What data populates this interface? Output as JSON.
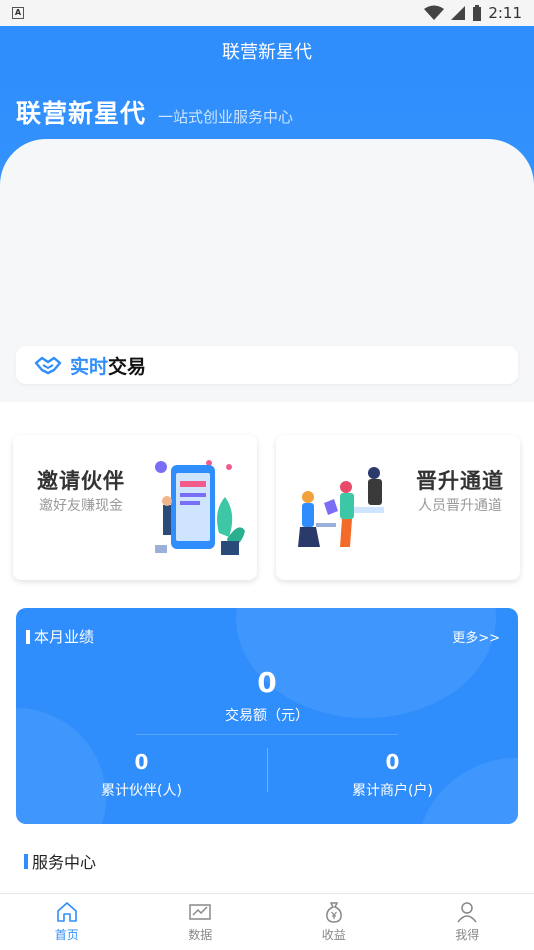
{
  "status_bar": {
    "sim_label": "A",
    "time": "2:11"
  },
  "header": {
    "title": "联营新星代"
  },
  "hero": {
    "brand_name": "联营新星代",
    "brand_slogan": "一站式创业服务中心",
    "realtime_label_a": "实时",
    "realtime_label_b": "交易"
  },
  "cards": [
    {
      "title": "邀请伙伴",
      "subtitle": "邀好友赚现金"
    },
    {
      "title": "晋升通道",
      "subtitle": "人员晋升通道"
    }
  ],
  "performance": {
    "title": "本月业绩",
    "more": "更多>>",
    "amount": "0",
    "amount_label": "交易额（元）",
    "partners_value": "0",
    "partners_label": "累计伙伴(人)",
    "merchants_value": "0",
    "merchants_label": "累计商户(户)"
  },
  "service_center": {
    "title": "服务中心"
  },
  "bottom_nav": [
    {
      "label": "首页",
      "icon": "home-icon",
      "active": true
    },
    {
      "label": "数据",
      "icon": "chart-icon",
      "active": false
    },
    {
      "label": "收益",
      "icon": "money-bag-icon",
      "active": false
    },
    {
      "label": "我得",
      "icon": "user-icon",
      "active": false
    }
  ],
  "colors": {
    "primary": "#2f8efc",
    "background": "#f6f7f9"
  }
}
